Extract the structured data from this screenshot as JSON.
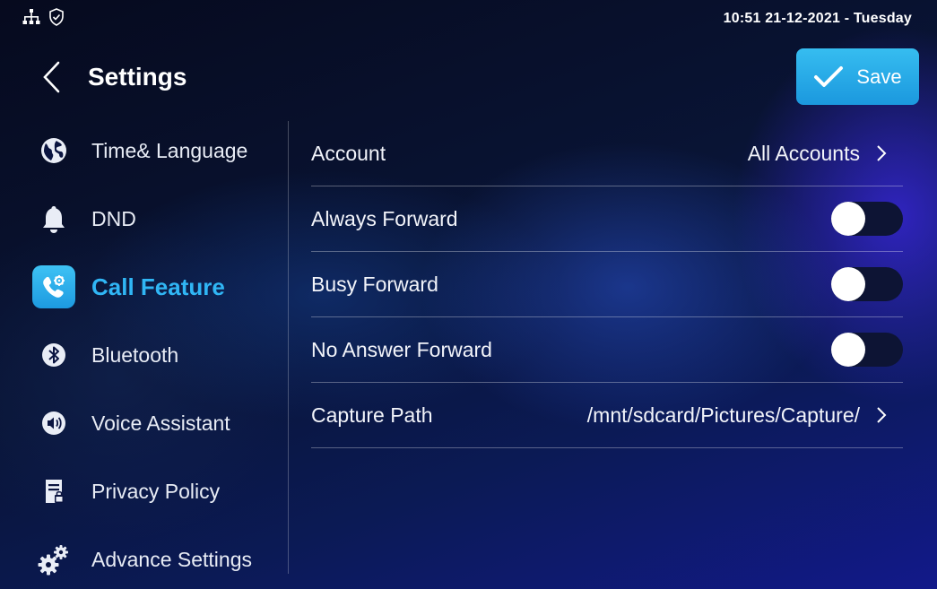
{
  "status_bar": {
    "datetime": "10:51  21-12-2021 - Tuesday",
    "icons": [
      "network-icon",
      "shield-check-icon"
    ]
  },
  "header": {
    "title": "Settings",
    "back_icon": "chevron-left-icon",
    "save_label": "Save",
    "save_icon": "checkmark-icon"
  },
  "sidebar": {
    "items": [
      {
        "label": "Time& Language",
        "icon": "globe-icon",
        "active": false
      },
      {
        "label": "DND",
        "icon": "bell-icon",
        "active": false
      },
      {
        "label": "Call Feature",
        "icon": "phone-settings-icon",
        "active": true
      },
      {
        "label": "Bluetooth",
        "icon": "bluetooth-icon",
        "active": false
      },
      {
        "label": "Voice Assistant",
        "icon": "speaker-icon",
        "active": false
      },
      {
        "label": "Privacy Policy",
        "icon": "document-lock-icon",
        "active": false
      },
      {
        "label": "Advance Settings",
        "icon": "gears-icon",
        "active": false
      }
    ]
  },
  "settings": {
    "rows": [
      {
        "label": "Account",
        "value": "All Accounts",
        "type": "link"
      },
      {
        "label": "Always Forward",
        "type": "toggle",
        "on": false
      },
      {
        "label": "Busy Forward",
        "type": "toggle",
        "on": false
      },
      {
        "label": "No Answer Forward",
        "type": "toggle",
        "on": false
      },
      {
        "label": "Capture Path",
        "value": "/mnt/sdcard/Pictures/Capture/",
        "type": "link"
      }
    ]
  },
  "colors": {
    "accent": "#30b6f5",
    "save_button": "#1b98de",
    "toggle_off_track": "#0d1434",
    "background": "#060b22"
  }
}
